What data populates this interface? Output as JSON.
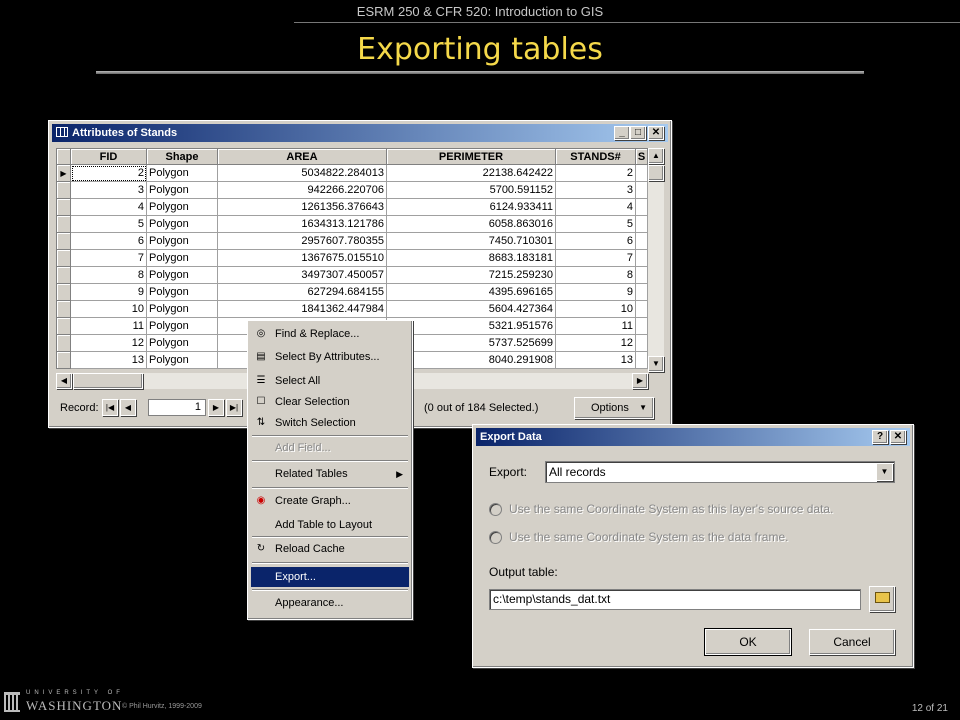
{
  "slide": {
    "header": "ESRM 250 & CFR 520: Introduction to GIS",
    "title": "Exporting tables",
    "copyright": "© Phil Hurvitz, 1999-2009",
    "page": "12 of 21",
    "logo_university": "UNIVERSITY OF",
    "logo_name": "WASHINGTON"
  },
  "attr_window": {
    "title": "Attributes of Stands",
    "columns": [
      "FID",
      "Shape",
      "AREA",
      "PERIMETER",
      "STANDS#",
      "S"
    ],
    "rows": [
      {
        "fid": "2",
        "shape": "Polygon",
        "area": "5034822.284013",
        "perimeter": "22138.642422",
        "stands": "2"
      },
      {
        "fid": "3",
        "shape": "Polygon",
        "area": "942266.220706",
        "perimeter": "5700.591152",
        "stands": "3"
      },
      {
        "fid": "4",
        "shape": "Polygon",
        "area": "1261356.376643",
        "perimeter": "6124.933411",
        "stands": "4"
      },
      {
        "fid": "5",
        "shape": "Polygon",
        "area": "1634313.121786",
        "perimeter": "6058.863016",
        "stands": "5"
      },
      {
        "fid": "6",
        "shape": "Polygon",
        "area": "2957607.780355",
        "perimeter": "7450.710301",
        "stands": "6"
      },
      {
        "fid": "7",
        "shape": "Polygon",
        "area": "1367675.015510",
        "perimeter": "8683.183181",
        "stands": "7"
      },
      {
        "fid": "8",
        "shape": "Polygon",
        "area": "3497307.450057",
        "perimeter": "7215.259230",
        "stands": "8"
      },
      {
        "fid": "9",
        "shape": "Polygon",
        "area": "627294.684155",
        "perimeter": "4395.696165",
        "stands": "9"
      },
      {
        "fid": "10",
        "shape": "Polygon",
        "area": "1841362.447984",
        "perimeter": "5604.427364",
        "stands": "10"
      },
      {
        "fid": "11",
        "shape": "Polygon",
        "area": "",
        "perimeter": "5321.951576",
        "stands": "11"
      },
      {
        "fid": "12",
        "shape": "Polygon",
        "area": "",
        "perimeter": "5737.525699",
        "stands": "12"
      },
      {
        "fid": "13",
        "shape": "Polygon",
        "area": "",
        "perimeter": "8040.291908",
        "stands": "13"
      }
    ],
    "record_label": "Record:",
    "record_value": "1",
    "selection_status": "(0 out of 184 Selected.)",
    "options_label": "Options"
  },
  "context_menu": {
    "items": [
      {
        "label": "Find & Replace...",
        "icon": "binoculars-icon"
      },
      {
        "label": "Select By Attributes...",
        "icon": "sql-icon"
      },
      {
        "label": "Select All",
        "icon": "select-all-icon"
      },
      {
        "label": "Clear Selection",
        "icon": "clear-selection-icon"
      },
      {
        "label": "Switch Selection",
        "icon": "switch-selection-icon"
      },
      {
        "label": "Add Field...",
        "disabled": true
      },
      {
        "label": "Related Tables"
      },
      {
        "label": "Create Graph...",
        "icon": "graph-icon"
      },
      {
        "label": "Add Table to Layout"
      },
      {
        "label": "Reload Cache",
        "icon": "reload-icon"
      },
      {
        "label": "Export...",
        "active": true
      },
      {
        "label": "Appearance..."
      }
    ]
  },
  "export_dialog": {
    "title": "Export Data",
    "export_label": "Export:",
    "export_value": "All records",
    "option1": "Use the same Coordinate System as this layer's source data.",
    "option2": "Use the same Coordinate System as the data frame.",
    "output_label": "Output table:",
    "output_value": "c:\\temp\\stands_dat.txt",
    "ok_label": "OK",
    "cancel_label": "Cancel"
  },
  "colors": {
    "title_accent": "#f5d94a",
    "titlebar": "#0a246a",
    "window_face": "#d4d0c8"
  }
}
